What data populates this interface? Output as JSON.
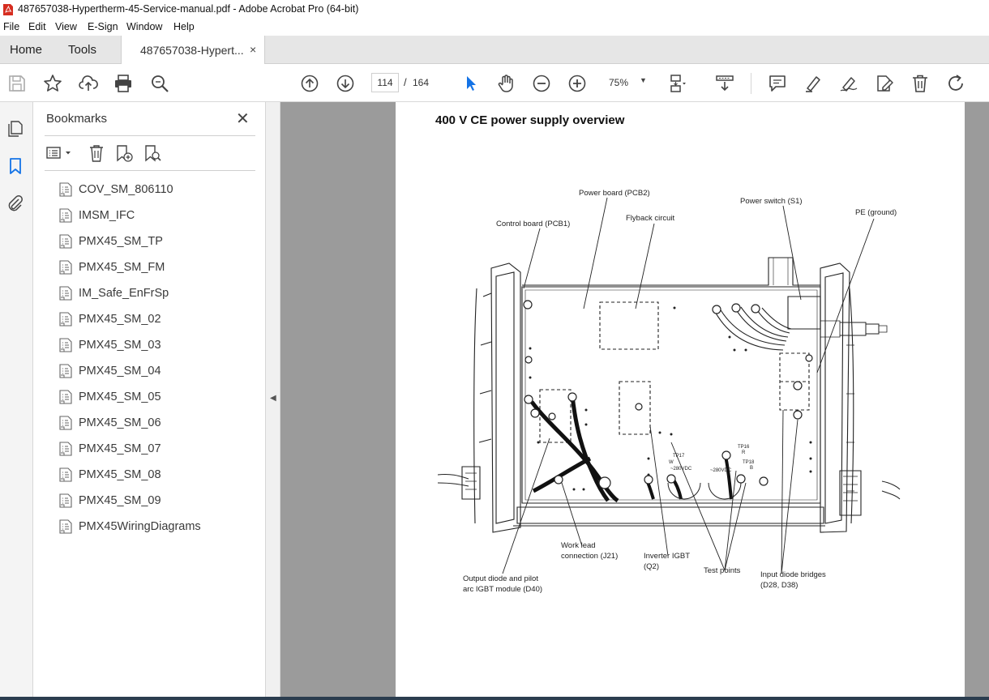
{
  "window": {
    "title": "487657038-Hypertherm-45-Service-manual.pdf - Adobe Acrobat Pro (64-bit)",
    "accent": "#d62d20"
  },
  "menu": [
    "File",
    "Edit",
    "View",
    "E-Sign",
    "Window",
    "Help"
  ],
  "tabs": {
    "home": "Home",
    "tools": "Tools",
    "document": "487657038-Hypert...",
    "close": "×"
  },
  "toolbar": {
    "page_current": "114",
    "page_separator": "/",
    "page_total": "164",
    "zoom": "75%",
    "icons": [
      "save-icon",
      "star-icon",
      "upload-icon",
      "print-icon",
      "find-icon",
      "page-up-icon",
      "page-down-icon",
      "select-cursor-icon",
      "hand-icon",
      "zoom-out-icon",
      "zoom-in-icon",
      "page-view-icon",
      "scroll-mode-icon",
      "comment-icon",
      "highlight-icon",
      "sign-icon",
      "fill-sign-icon",
      "delete-icon",
      "rotate-icon"
    ]
  },
  "rail": {
    "icons": [
      "pages-icon",
      "bookmark-icon",
      "attachment-icon"
    ]
  },
  "bookmarks": {
    "heading": "Bookmarks",
    "close": "✕",
    "items": [
      "COV_SM_806110",
      "IMSM_IFC",
      "PMX45_SM_TP",
      "PMX45_SM_FM",
      "IM_Safe_EnFrSp",
      "PMX45_SM_02",
      "PMX45_SM_03",
      "PMX45_SM_04",
      "PMX45_SM_05",
      "PMX45_SM_06",
      "PMX45_SM_07",
      "PMX45_SM_08",
      "PMX45_SM_09",
      "PMX45WiringDiagrams"
    ]
  },
  "document": {
    "title": "400 V CE power supply overview",
    "labels": {
      "power_board": "Power board (PCB2)",
      "control_board": "Control board (PCB1)",
      "flyback": "Flyback circuit",
      "power_switch": "Power switch (S1)",
      "pe_ground": "PE (ground)",
      "work_lead_1": "Work lead",
      "work_lead_2": "connection (J21)",
      "inverter_1": "Inverter IGBT",
      "inverter_2": "(Q2)",
      "test_points": "Test points",
      "input_diode_1": "Input diode bridges",
      "input_diode_2": "(D28, D38)",
      "output_diode_1": "Output diode and pilot",
      "output_diode_2": "arc IGBT module (D40)",
      "tp17": "TP17",
      "tp17_w": "W",
      "tp16": "TP16",
      "tp16_r": "R",
      "tp18": "TP18",
      "tp18_b": "B",
      "vdc_left": "~280VDC",
      "vdc_right": "~280VDC"
    }
  }
}
